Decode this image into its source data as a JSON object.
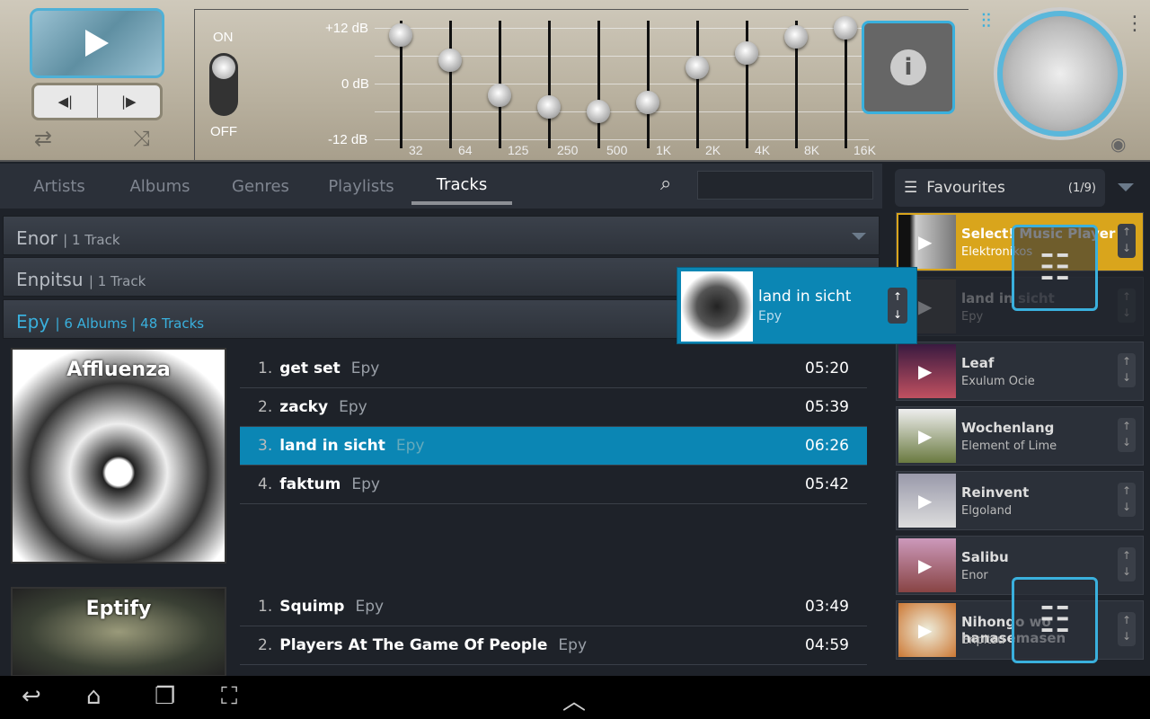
{
  "player": {
    "play_icon": "play-icon",
    "prev_icon": "previous-icon",
    "next_icon": "next-icon",
    "repeat_icon": "repeat-icon",
    "shuffle_icon": "shuffle-icon"
  },
  "equalizer": {
    "on_label": "ON",
    "off_label": "OFF",
    "enabled": true,
    "db_labels": [
      "+12 dB",
      "0 dB",
      "-12 dB"
    ],
    "bands": [
      {
        "freq": "32",
        "gain_db": 10.5
      },
      {
        "freq": "64",
        "gain_db": 5
      },
      {
        "freq": "125",
        "gain_db": -2.5
      },
      {
        "freq": "250",
        "gain_db": -5
      },
      {
        "freq": "500",
        "gain_db": -6
      },
      {
        "freq": "1K",
        "gain_db": -4
      },
      {
        "freq": "2K",
        "gain_db": 3.5
      },
      {
        "freq": "4K",
        "gain_db": 6.5
      },
      {
        "freq": "8K",
        "gain_db": 10
      },
      {
        "freq": "16K",
        "gain_db": 12
      }
    ]
  },
  "tabs": [
    {
      "label": "Artists"
    },
    {
      "label": "Albums"
    },
    {
      "label": "Genres"
    },
    {
      "label": "Playlists"
    },
    {
      "label": "Tracks",
      "active": true
    }
  ],
  "groups": [
    {
      "name": "Enor",
      "info": "1 Track"
    },
    {
      "name": "Enpitsu",
      "info": "1 Track"
    },
    {
      "name": "Epy",
      "albums": "6 Albums",
      "tracks": "48 Tracks"
    }
  ],
  "albums": [
    {
      "title": "Affluenza",
      "tracks": [
        {
          "n": "1.",
          "title": "get set",
          "artist": "Epy",
          "dur": "05:20"
        },
        {
          "n": "2.",
          "title": "zacky",
          "artist": "Epy",
          "dur": "05:39"
        },
        {
          "n": "3.",
          "title": "land in sicht",
          "artist": "Epy",
          "dur": "06:26",
          "selected": true
        },
        {
          "n": "4.",
          "title": "faktum",
          "artist": "Epy",
          "dur": "05:42"
        }
      ]
    },
    {
      "title": "Eptify",
      "tracks": [
        {
          "n": "1.",
          "title": "Squimp",
          "artist": "Epy",
          "dur": "03:49"
        },
        {
          "n": "2.",
          "title": "Players At The Game Of People",
          "artist": "Epy",
          "dur": "04:59"
        }
      ]
    }
  ],
  "playlist": {
    "title": "Favourites",
    "count": "(1/9)",
    "items": [
      {
        "title": "Select! Music Player",
        "artist": "Elektronikos",
        "playing": true
      },
      {
        "title": "land in sicht",
        "artist": "Epy"
      },
      {
        "title": "Leaf",
        "artist": "Exulum Ocie"
      },
      {
        "title": "Wochenlang",
        "artist": "Element of Lime"
      },
      {
        "title": "Reinvent",
        "artist": "Elgoland"
      },
      {
        "title": "Salibu",
        "artist": "Enor"
      },
      {
        "title": "Nihongo wo hanasemasen",
        "artist": "Enpitsu"
      }
    ]
  },
  "drag": {
    "title": "land in sicht",
    "artist": "Epy"
  },
  "colors": {
    "accent": "#3ab0dd",
    "selected": "#0b86b4",
    "now_playing": "#d9a51c"
  }
}
